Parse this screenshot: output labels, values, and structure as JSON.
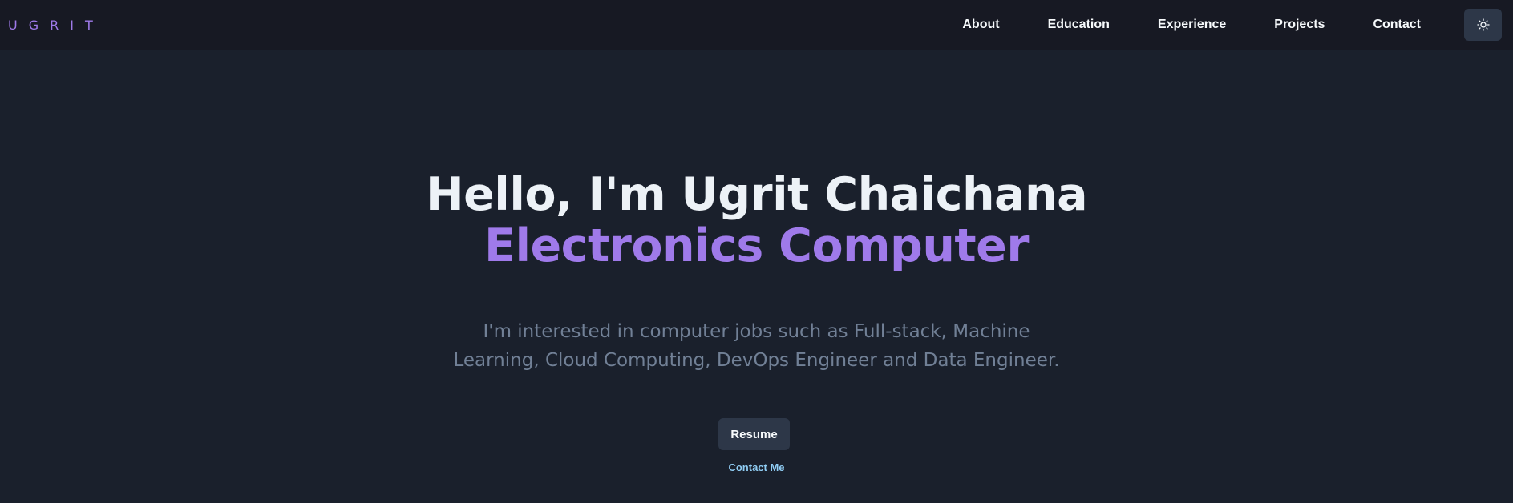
{
  "navbar": {
    "logo": "UGRIT",
    "links": [
      "About",
      "Education",
      "Experience",
      "Projects",
      "Contact"
    ],
    "theme_toggle_icon": "sun-icon"
  },
  "hero": {
    "title": "Hello, I'm Ugrit Chaichana",
    "subtitle": "Electronics Computer",
    "description": "I'm interested in computer jobs such as Full-stack, Machine Learning, Cloud Computing, DevOps Engineer and Data Engineer.",
    "resume_label": "Resume",
    "contact_label": "Contact Me"
  },
  "colors": {
    "background": "#1a202c",
    "navbar_background": "#171923",
    "accent_purple": "#9f7aea",
    "link_blue": "#90cdf4",
    "muted_text": "#718096",
    "button_background": "#2d3748"
  }
}
